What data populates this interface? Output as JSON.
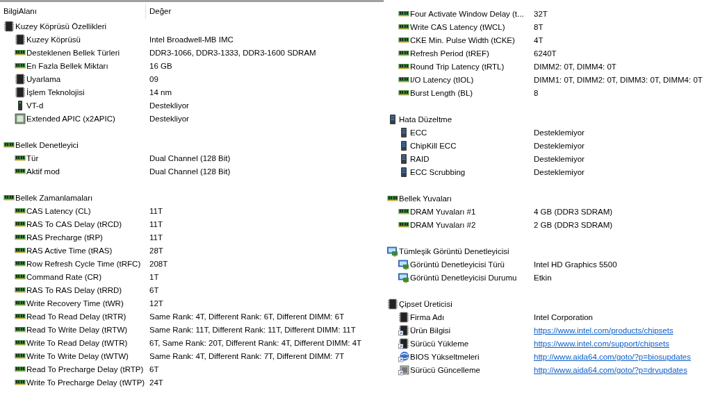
{
  "header": {
    "columns": [
      "BilgiAlanı",
      "Değer"
    ]
  },
  "left_groups": [
    {
      "title": "Kuzey Köprüsü Özellikleri",
      "kind": "chip",
      "items": [
        {
          "label": "Kuzey Köprüsü",
          "value": "Intel Broadwell-MB IMC",
          "kind": "chip"
        },
        {
          "label": "Desteklenen Bellek Türleri",
          "value": "DDR3-1066, DDR3-1333, DDR3-1600 SDRAM",
          "kind": "memory"
        },
        {
          "label": "En Fazla Bellek Miktarı",
          "value": "16 GB",
          "kind": "memory"
        },
        {
          "label": "Uyarlama",
          "value": "09",
          "kind": "chip"
        },
        {
          "label": "İşlem Teknolojisi",
          "value": "14 nm",
          "kind": "chip"
        },
        {
          "label": "VT-d",
          "value": "Destekliyor",
          "kind": "vtd"
        },
        {
          "label": "Extended APIC (x2APIC)",
          "value": "Destekliyor",
          "kind": "cpu"
        }
      ]
    },
    {
      "title": "Bellek Denetleyici",
      "kind": "memory",
      "items": [
        {
          "label": "Tür",
          "value": "Dual Channel  (128 Bit)",
          "kind": "memory"
        },
        {
          "label": "Aktif mod",
          "value": "Dual Channel  (128 Bit)",
          "kind": "memory"
        }
      ]
    },
    {
      "title": "Bellek Zamanlamaları",
      "kind": "memory",
      "items": [
        {
          "label": "CAS Latency (CL)",
          "value": "11T",
          "kind": "memory"
        },
        {
          "label": "RAS To CAS Delay (tRCD)",
          "value": "11T",
          "kind": "memory"
        },
        {
          "label": "RAS Precharge (tRP)",
          "value": "11T",
          "kind": "memory"
        },
        {
          "label": "RAS Active Time (tRAS)",
          "value": "28T",
          "kind": "memory"
        },
        {
          "label": "Row Refresh Cycle Time (tRFC)",
          "value": "208T",
          "kind": "memory"
        },
        {
          "label": "Command Rate (CR)",
          "value": "1T",
          "kind": "memory"
        },
        {
          "label": "RAS To RAS Delay (tRRD)",
          "value": "6T",
          "kind": "memory"
        },
        {
          "label": "Write Recovery Time (tWR)",
          "value": "12T",
          "kind": "memory"
        },
        {
          "label": "Read To Read Delay (tRTR)",
          "value": "Same Rank: 4T, Different Rank: 6T, Different DIMM: 6T",
          "kind": "memory"
        },
        {
          "label": "Read To Write Delay (tRTW)",
          "value": "Same Rank: 11T, Different Rank: 11T, Different DIMM: 11T",
          "kind": "memory"
        },
        {
          "label": "Write To Read Delay (tWTR)",
          "value": "6T, Same Rank: 20T, Different Rank: 4T, Different DIMM: 4T",
          "kind": "memory"
        },
        {
          "label": "Write To Write Delay (tWTW)",
          "value": "Same Rank: 4T, Different Rank: 7T, Different DIMM: 7T",
          "kind": "memory"
        },
        {
          "label": "Read To Precharge Delay (tRTP)",
          "value": "6T",
          "kind": "memory"
        },
        {
          "label": "Write To Precharge Delay (tWTP)",
          "value": "24T",
          "kind": "memory"
        }
      ]
    }
  ],
  "right_groups": [
    {
      "items": [
        {
          "label": "Four Activate Window Delay (t...",
          "value": "32T",
          "kind": "memory"
        },
        {
          "label": "Write CAS Latency (tWCL)",
          "value": "8T",
          "kind": "memory"
        },
        {
          "label": "CKE Min. Pulse Width (tCKE)",
          "value": "4T",
          "kind": "memory"
        },
        {
          "label": "Refresh Period (tREF)",
          "value": "6240T",
          "kind": "memory"
        },
        {
          "label": "Round Trip Latency (tRTL)",
          "value": "DIMM2: 0T, DIMM4: 0T",
          "kind": "memory"
        },
        {
          "label": "I/O Latency (tIOL)",
          "value": "DIMM1: 0T, DIMM2: 0T, DIMM3: 0T, DIMM4: 0T",
          "kind": "memory"
        },
        {
          "label": "Burst Length (BL)",
          "value": "8",
          "kind": "memory"
        }
      ]
    },
    {
      "title": "Hata Düzeltme",
      "kind": "server",
      "items": [
        {
          "label": "ECC",
          "value": "Desteklemiyor",
          "kind": "server"
        },
        {
          "label": "ChipKill ECC",
          "value": "Desteklemiyor",
          "kind": "server"
        },
        {
          "label": "RAID",
          "value": "Desteklemiyor",
          "kind": "server"
        },
        {
          "label": "ECC Scrubbing",
          "value": "Desteklemiyor",
          "kind": "server"
        }
      ]
    },
    {
      "title": "Bellek Yuvaları",
      "kind": "memory",
      "items": [
        {
          "label": "DRAM Yuvaları #1",
          "value": "4 GB  (DDR3 SDRAM)",
          "kind": "memory"
        },
        {
          "label": "DRAM Yuvaları #2",
          "value": "2 GB  (DDR3 SDRAM)",
          "kind": "memory"
        }
      ]
    },
    {
      "title": "Tümleşik Görüntü Denetleyicisi",
      "kind": "display",
      "items": [
        {
          "label": "Görüntü Denetleyicisi Türü",
          "value": "Intel HD Graphics 5500",
          "kind": "display"
        },
        {
          "label": "Görüntü Denetleyicisi Durumu",
          "value": "Etkin",
          "kind": "display"
        }
      ]
    },
    {
      "title": "Çipset Üreticisi",
      "kind": "chip",
      "items": [
        {
          "label": "Firma Adı",
          "value": "Intel Corporation",
          "kind": "chip",
          "link": false
        },
        {
          "label": "Ürün Bilgisi",
          "value": "https://www.intel.com/products/chipsets",
          "kind": "chip-link",
          "link": true
        },
        {
          "label": "Sürücü Yükleme",
          "value": "https://www.intel.com/support/chipsets",
          "kind": "chip-link",
          "link": true
        },
        {
          "label": "BIOS Yükseltmeleri",
          "value": "http://www.aida64.com/goto/?p=biosupdates",
          "kind": "bios",
          "link": true
        },
        {
          "label": "Sürücü Güncelleme",
          "value": "http://www.aida64.com/goto/?p=drvupdates",
          "kind": "update",
          "link": true
        }
      ]
    }
  ]
}
